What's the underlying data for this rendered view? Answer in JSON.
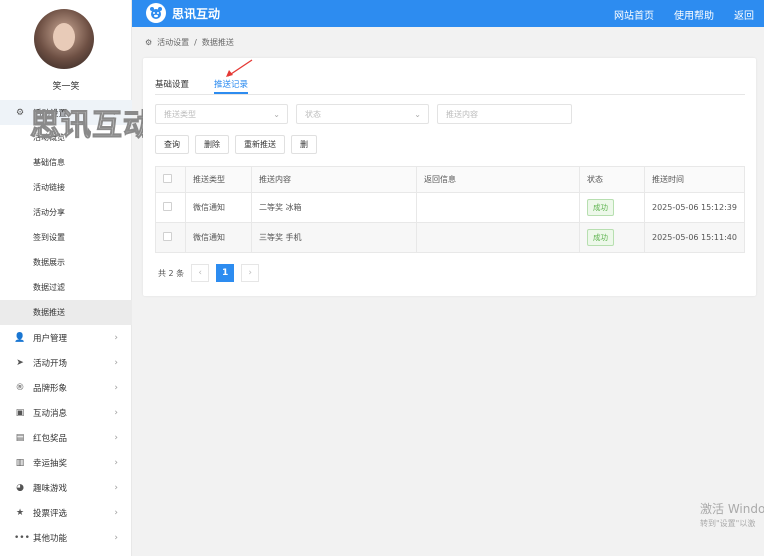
{
  "app": {
    "brand": "思讯互动",
    "nav": [
      "网站首页",
      "使用帮助",
      "返回"
    ]
  },
  "user": {
    "name": "笑一笑"
  },
  "sidebar": {
    "activity_settings": "活动设置",
    "sub_items": [
      "活动概览",
      "基础信息",
      "活动链接",
      "活动分享",
      "签到设置",
      "数据展示",
      "数据过滤",
      "数据推送"
    ],
    "menu": [
      {
        "label": "用户管理",
        "icon": "user-shield-icon"
      },
      {
        "label": "活动开场",
        "icon": "send-icon"
      },
      {
        "label": "品牌形象",
        "icon": "registered-icon"
      },
      {
        "label": "互动消息",
        "icon": "message-icon"
      },
      {
        "label": "红包奖品",
        "icon": "gift-icon"
      },
      {
        "label": "幸运抽奖",
        "icon": "lottery-icon"
      },
      {
        "label": "趣味游戏",
        "icon": "game-icon"
      },
      {
        "label": "投票评选",
        "icon": "star-icon"
      },
      {
        "label": "其他功能",
        "icon": "more-icon"
      }
    ]
  },
  "watermark": "思讯互动",
  "breadcrumb": {
    "parent": "活动设置",
    "sep": "/",
    "current": "数据推送"
  },
  "tabs": [
    "基础设置",
    "推送记录"
  ],
  "filters": {
    "push_type_placeholder": "推送类型",
    "status_placeholder": "状态",
    "content_placeholder": "推送内容"
  },
  "buttons": {
    "query": "查询",
    "delete": "删除",
    "repush": "重新推送",
    "extra": "删"
  },
  "table": {
    "headers": [
      "推送类型",
      "推送内容",
      "返回信息",
      "状态",
      "推送时间"
    ],
    "rows": [
      {
        "type": "微信通知",
        "content": "二等奖 冰箱",
        "response": "",
        "status": "成功",
        "time": "2025-05-06 15:12:39"
      },
      {
        "type": "微信通知",
        "content": "三等奖 手机",
        "response": "",
        "status": "成功",
        "time": "2025-05-06 15:11:40"
      }
    ]
  },
  "pagination": {
    "total": "共 2 条",
    "current": "1",
    "prev": "‹",
    "next": "›"
  },
  "windows_activation": {
    "title": "激活 Windo",
    "sub": "转到\"设置\"以激"
  },
  "colors": {
    "primary": "#2d8cf0",
    "success": "#5fb450"
  }
}
